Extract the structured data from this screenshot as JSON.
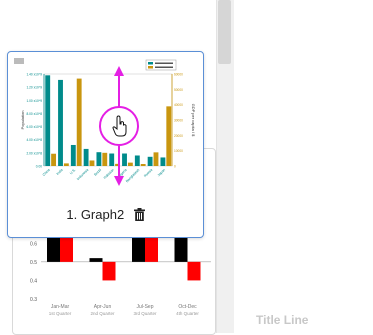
{
  "card": {
    "title": "1. Graph2",
    "icons": [
      "trash-icon",
      "move-handle-icon",
      "hand-cursor-icon"
    ]
  },
  "right_panel": {
    "title_line_label": "Title Line"
  },
  "colors": {
    "teal": "#008b8b",
    "gold": "#c9960f",
    "magenta": "#e41fe4",
    "card_border": "#5b8fd6",
    "red": "#ff0000",
    "black": "#000000"
  },
  "chart_data": [
    {
      "type": "bar",
      "categories": [
        "China",
        "India",
        "U.S.",
        "Indonesia",
        "Brazil",
        "Pakistan",
        "Nigeria",
        "Bangladesh",
        "Russia",
        "Japan"
      ],
      "series": [
        {
          "values": [
            1.38,
            1.31,
            0.32,
            0.26,
            0.21,
            0.19,
            0.19,
            0.16,
            0.14,
            0.13
          ]
        },
        {
          "values": [
            8000,
            1700,
            57000,
            3600,
            8600,
            1400,
            2200,
            1300,
            8900,
            38900
          ]
        }
      ],
      "ylabel_left": "Population",
      "ylabel_right": "GDP per capita / $",
      "yticks_left": [
        "0.00",
        "2.00 x10^8",
        "4.00 x10^8",
        "6.00 x10^8",
        "8.00 x10^8",
        "1.00 x10^9",
        "1.20 x10^9",
        "1.40 x10^9"
      ],
      "yticks_right": [
        "0",
        "10000",
        "20000",
        "30000",
        "40000",
        "50000",
        "60000"
      ]
    },
    {
      "type": "bar",
      "categories": [
        "Jan-Mar",
        "Apr-Jun",
        "Jul-Sep",
        "Oct-Dec"
      ],
      "sublabels": [
        "1st Quarter",
        "2nd Quarter",
        "3rd Quarter",
        "4th Quarter"
      ],
      "series": [
        {
          "values": [
            0.7,
            0.52,
            0.7,
            0.7
          ]
        },
        {
          "values": [
            0.7,
            0.4,
            0.7,
            0.4
          ]
        }
      ],
      "yticks": [
        "0.3",
        "0.4",
        "0.5",
        "0.6"
      ],
      "ylim": [
        0.3,
        0.65
      ]
    }
  ]
}
